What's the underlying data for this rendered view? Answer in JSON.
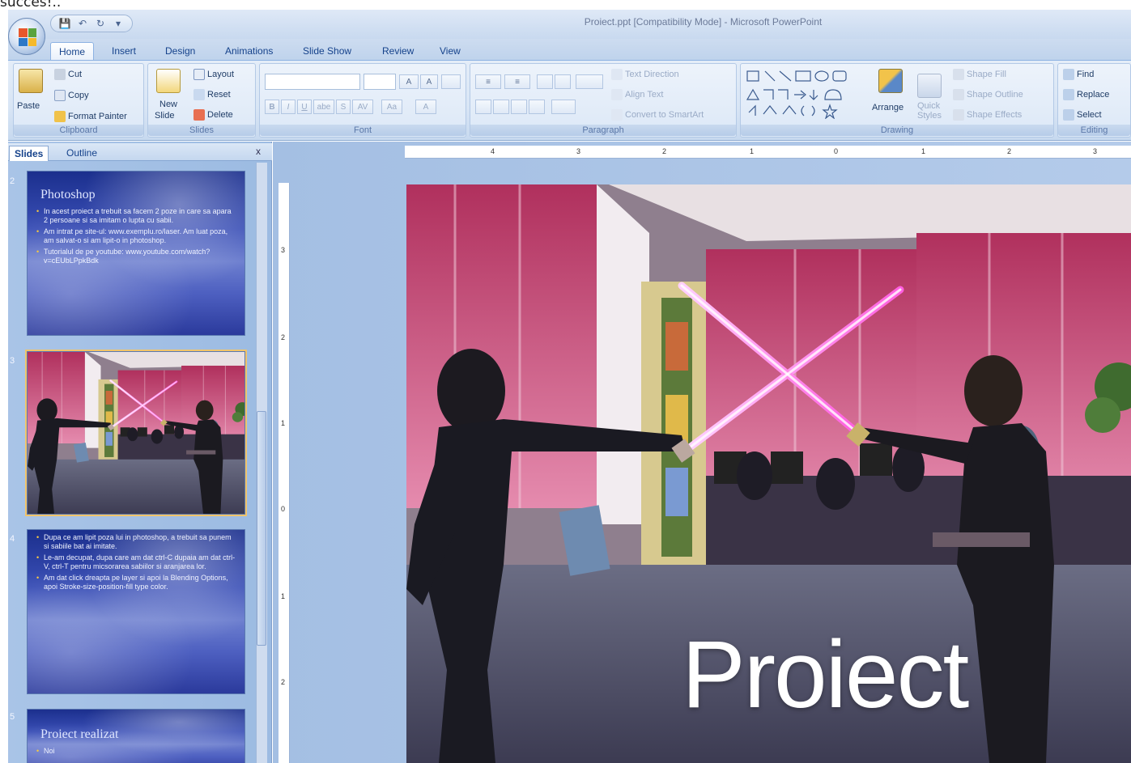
{
  "caption": "succes!..",
  "window": {
    "title": "Proiect.ppt [Compatibility Mode] - Microsoft PowerPoint"
  },
  "quick_access": {
    "save": "save-icon",
    "undo": "undo-icon",
    "redo": "redo-icon",
    "customize": "dropdown-icon"
  },
  "tabs": [
    {
      "label": "Home"
    },
    {
      "label": "Insert"
    },
    {
      "label": "Design"
    },
    {
      "label": "Animations"
    },
    {
      "label": "Slide Show"
    },
    {
      "label": "Review"
    },
    {
      "label": "View"
    }
  ],
  "ribbon": {
    "clipboard": {
      "label": "Clipboard",
      "paste": "Paste",
      "cut": "Cut",
      "copy": "Copy",
      "format_painter": "Format Painter"
    },
    "slides": {
      "label": "Slides",
      "new_slide": "New",
      "new_slide_2": "Slide",
      "layout": "Layout",
      "reset": "Reset",
      "delete": "Delete"
    },
    "font": {
      "label": "Font",
      "grow": "A",
      "shrink": "A",
      "bold": "B",
      "italic": "I",
      "underline": "U",
      "strike": "abe",
      "shadow": "S",
      "spacing": "AV",
      "change_case": "Aa",
      "color": "A"
    },
    "paragraph": {
      "label": "Paragraph",
      "text_direction": "Text Direction",
      "align_text": "Align Text",
      "convert_smartart": "Convert to SmartArt"
    },
    "drawing": {
      "label": "Drawing",
      "arrange": "Arrange",
      "quick_styles": "Quick",
      "quick_styles_2": "Styles",
      "shape_fill": "Shape Fill",
      "shape_outline": "Shape Outline",
      "shape_effects": "Shape Effects"
    },
    "editing": {
      "label": "Editing",
      "find": "Find",
      "replace": "Replace",
      "select": "Select"
    }
  },
  "left_pane": {
    "tab_slides": "Slides",
    "tab_outline": "Outline",
    "close": "x",
    "slides": [
      {
        "number": "2",
        "title": "Photoshop",
        "bullets": [
          "In acest proiect a trebuit sa facem 2 poze in care sa apara 2 persoane si sa imitam o lupta cu sabii.",
          "Am intrat pe site-ul: www.exemplu.ro/laser. Am luat poza, am salvat-o si am lipit-o in photoshop.",
          "Tutorialul de pe youtube: www.youtube.com/watch?v=cEUbLPpkBdk"
        ]
      },
      {
        "number": "3"
      },
      {
        "number": "4",
        "bullets": [
          "Dupa ce am lipit poza lui in photoshop, a trebuit sa punem si sabiile bat ai imitate.",
          "Le-am decupat, dupa care am dat ctrl-C dupaia am dat ctrl-V, ctrl-T pentru micsorarea sabiilor si aranjarea lor.",
          "Am dat click dreapta pe layer si apoi la Blending Options, apoi Stroke-size-position-fill type color."
        ]
      },
      {
        "number": "5",
        "title": "Proiect realizat",
        "partial": "Noi"
      }
    ]
  },
  "ruler": {
    "h": [
      "4",
      "3",
      "2",
      "1",
      "0",
      "1",
      "2",
      "3"
    ],
    "v": [
      "3",
      "2",
      "1",
      "0",
      "1",
      "2"
    ]
  },
  "slide": {
    "title": "Proiect"
  }
}
